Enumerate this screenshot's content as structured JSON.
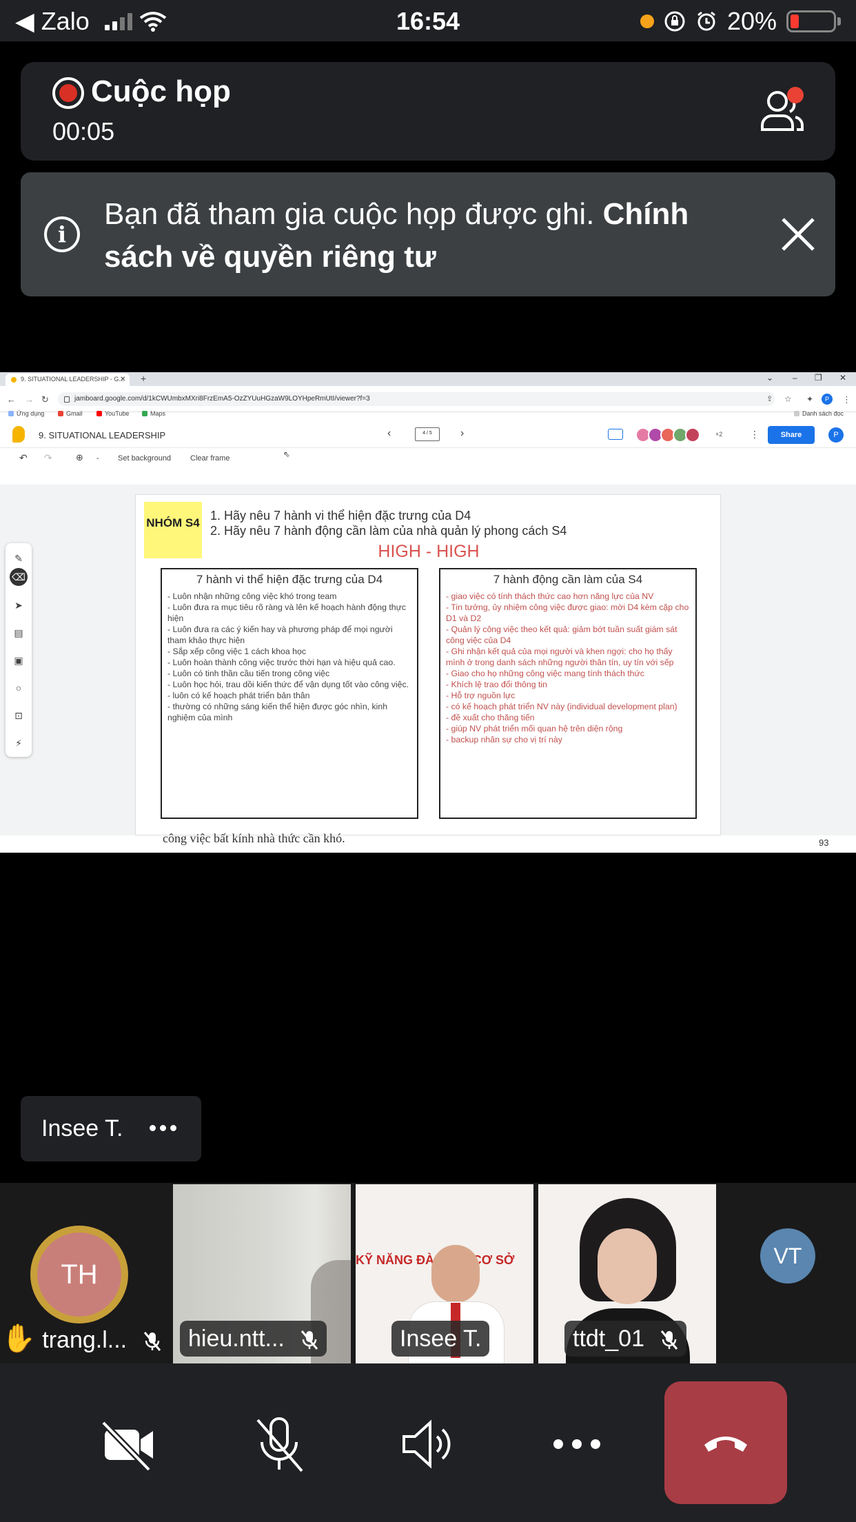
{
  "status_bar": {
    "back_app": "◀ Zalo",
    "time": "16:54",
    "battery": "20%"
  },
  "meeting": {
    "title": "Cuộc họp",
    "elapsed": "00:05"
  },
  "banner": {
    "text": "Bạn đã tham gia cuộc họp được ghi.",
    "link": "Chính sách về quyền riêng tư"
  },
  "browser": {
    "tab_title": "9. SITUATIONAL LEADERSHIP - G...",
    "url": "jamboard.google.com/d/1kCWUmbxMXri8FrzEmA5-OzZYUuHGzaW9LOYHpeRmUtI/viewer?f=3",
    "bookmarks": [
      "Ứng dụng",
      "Gmail",
      "YouTube",
      "Maps"
    ],
    "reading_list": "Danh sách đọc"
  },
  "jamboard": {
    "title": "9. SITUATIONAL LEADERSHIP",
    "frame_indicator": "4 / 5",
    "collab_extra": "+2",
    "share_label": "Share",
    "account_initial": "P",
    "toolbar": {
      "set_background": "Set background",
      "clear_frame": "Clear frame"
    }
  },
  "frame": {
    "sticky": "NHÓM S4",
    "question1": "1. Hãy nêu 7 hành vi thể hiện đặc trưng của D4",
    "question2": "2. Hãy nêu 7 hành động cần làm của nhà quản lý phong cách S4",
    "high": "HIGH - HIGH",
    "left_title": "7 hành vi thể hiện đặc trưng của D4",
    "left_items": [
      "- Luôn nhận những công việc khó trong team",
      "- Luôn đưa ra mục tiêu rõ ràng và lên kế hoạch hành động thực hiện",
      "- Luôn đưa ra các ý kiến hay và phương pháp để mọi người tham khảo thực hiện",
      "- Sắp xếp công việc 1 cách khoa học",
      "- Luôn hoàn thành công việc trước thời hạn và hiệu quả cao.",
      "- Luôn có tinh thần cầu tiến trong công việc",
      "- Luôn học hỏi, trau dồi kiến thức để vận dụng tốt vào công việc.",
      "- luôn có kế hoạch phát triển bản thân",
      "- thường có những sáng kiến thể hiện được góc nhìn, kinh nghiệm của mình"
    ],
    "right_title": "7 hành động cần làm của S4",
    "right_items": [
      "- giao việc có tính thách thức cao hơn năng lực của NV",
      "- Tin tưởng, ủy nhiệm công việc được giao: mời D4 kèm cặp cho D1 và D2",
      "- Quản lý công việc theo kết quả: giảm bớt tuần suất giám sát công việc của D4",
      "- Ghi nhận kết quả của mọi người và khen ngợi: cho họ thấy mình ở trong danh sách những người thân tín, uy tín với sếp",
      "- Giao cho họ những công việc mang tính thách thức",
      "- Khích lệ trao đổi thông tin",
      "- Hỗ trợ nguồn lực",
      "- có kế hoạch phát triển NV này (individual development plan)",
      "- đề xuất cho thăng tiến",
      "- giúp NV phát triển mối quan hệ trên diện rộng",
      "- backup nhân sự cho vị trí này"
    ]
  },
  "slide_footer": {
    "partial_text": "công việc bất kính nhà thức cần khó.",
    "page_number": "93"
  },
  "speaker": {
    "name": "Insee T."
  },
  "participants": [
    {
      "initials": "TH",
      "name": "trang.l..."
    },
    {
      "name": "hieu.ntt..."
    },
    {
      "name": "Insee T.",
      "backdrop_text": "KỸ NĂNG ĐÀO ... P CƠ SỞ"
    },
    {
      "name": "ttdt_01"
    },
    {
      "initials": "VT"
    }
  ],
  "controls": {
    "icons": [
      "camera-off-icon",
      "mic-off-icon",
      "speaker-icon",
      "more-icon",
      "end-call-icon"
    ],
    "end_call_color": "#a93d45"
  },
  "colors": {
    "record_red": "#d93025",
    "sticky_yellow": "#fef77a",
    "high_red": "#d9534f",
    "share_blue": "#1a73e8"
  }
}
